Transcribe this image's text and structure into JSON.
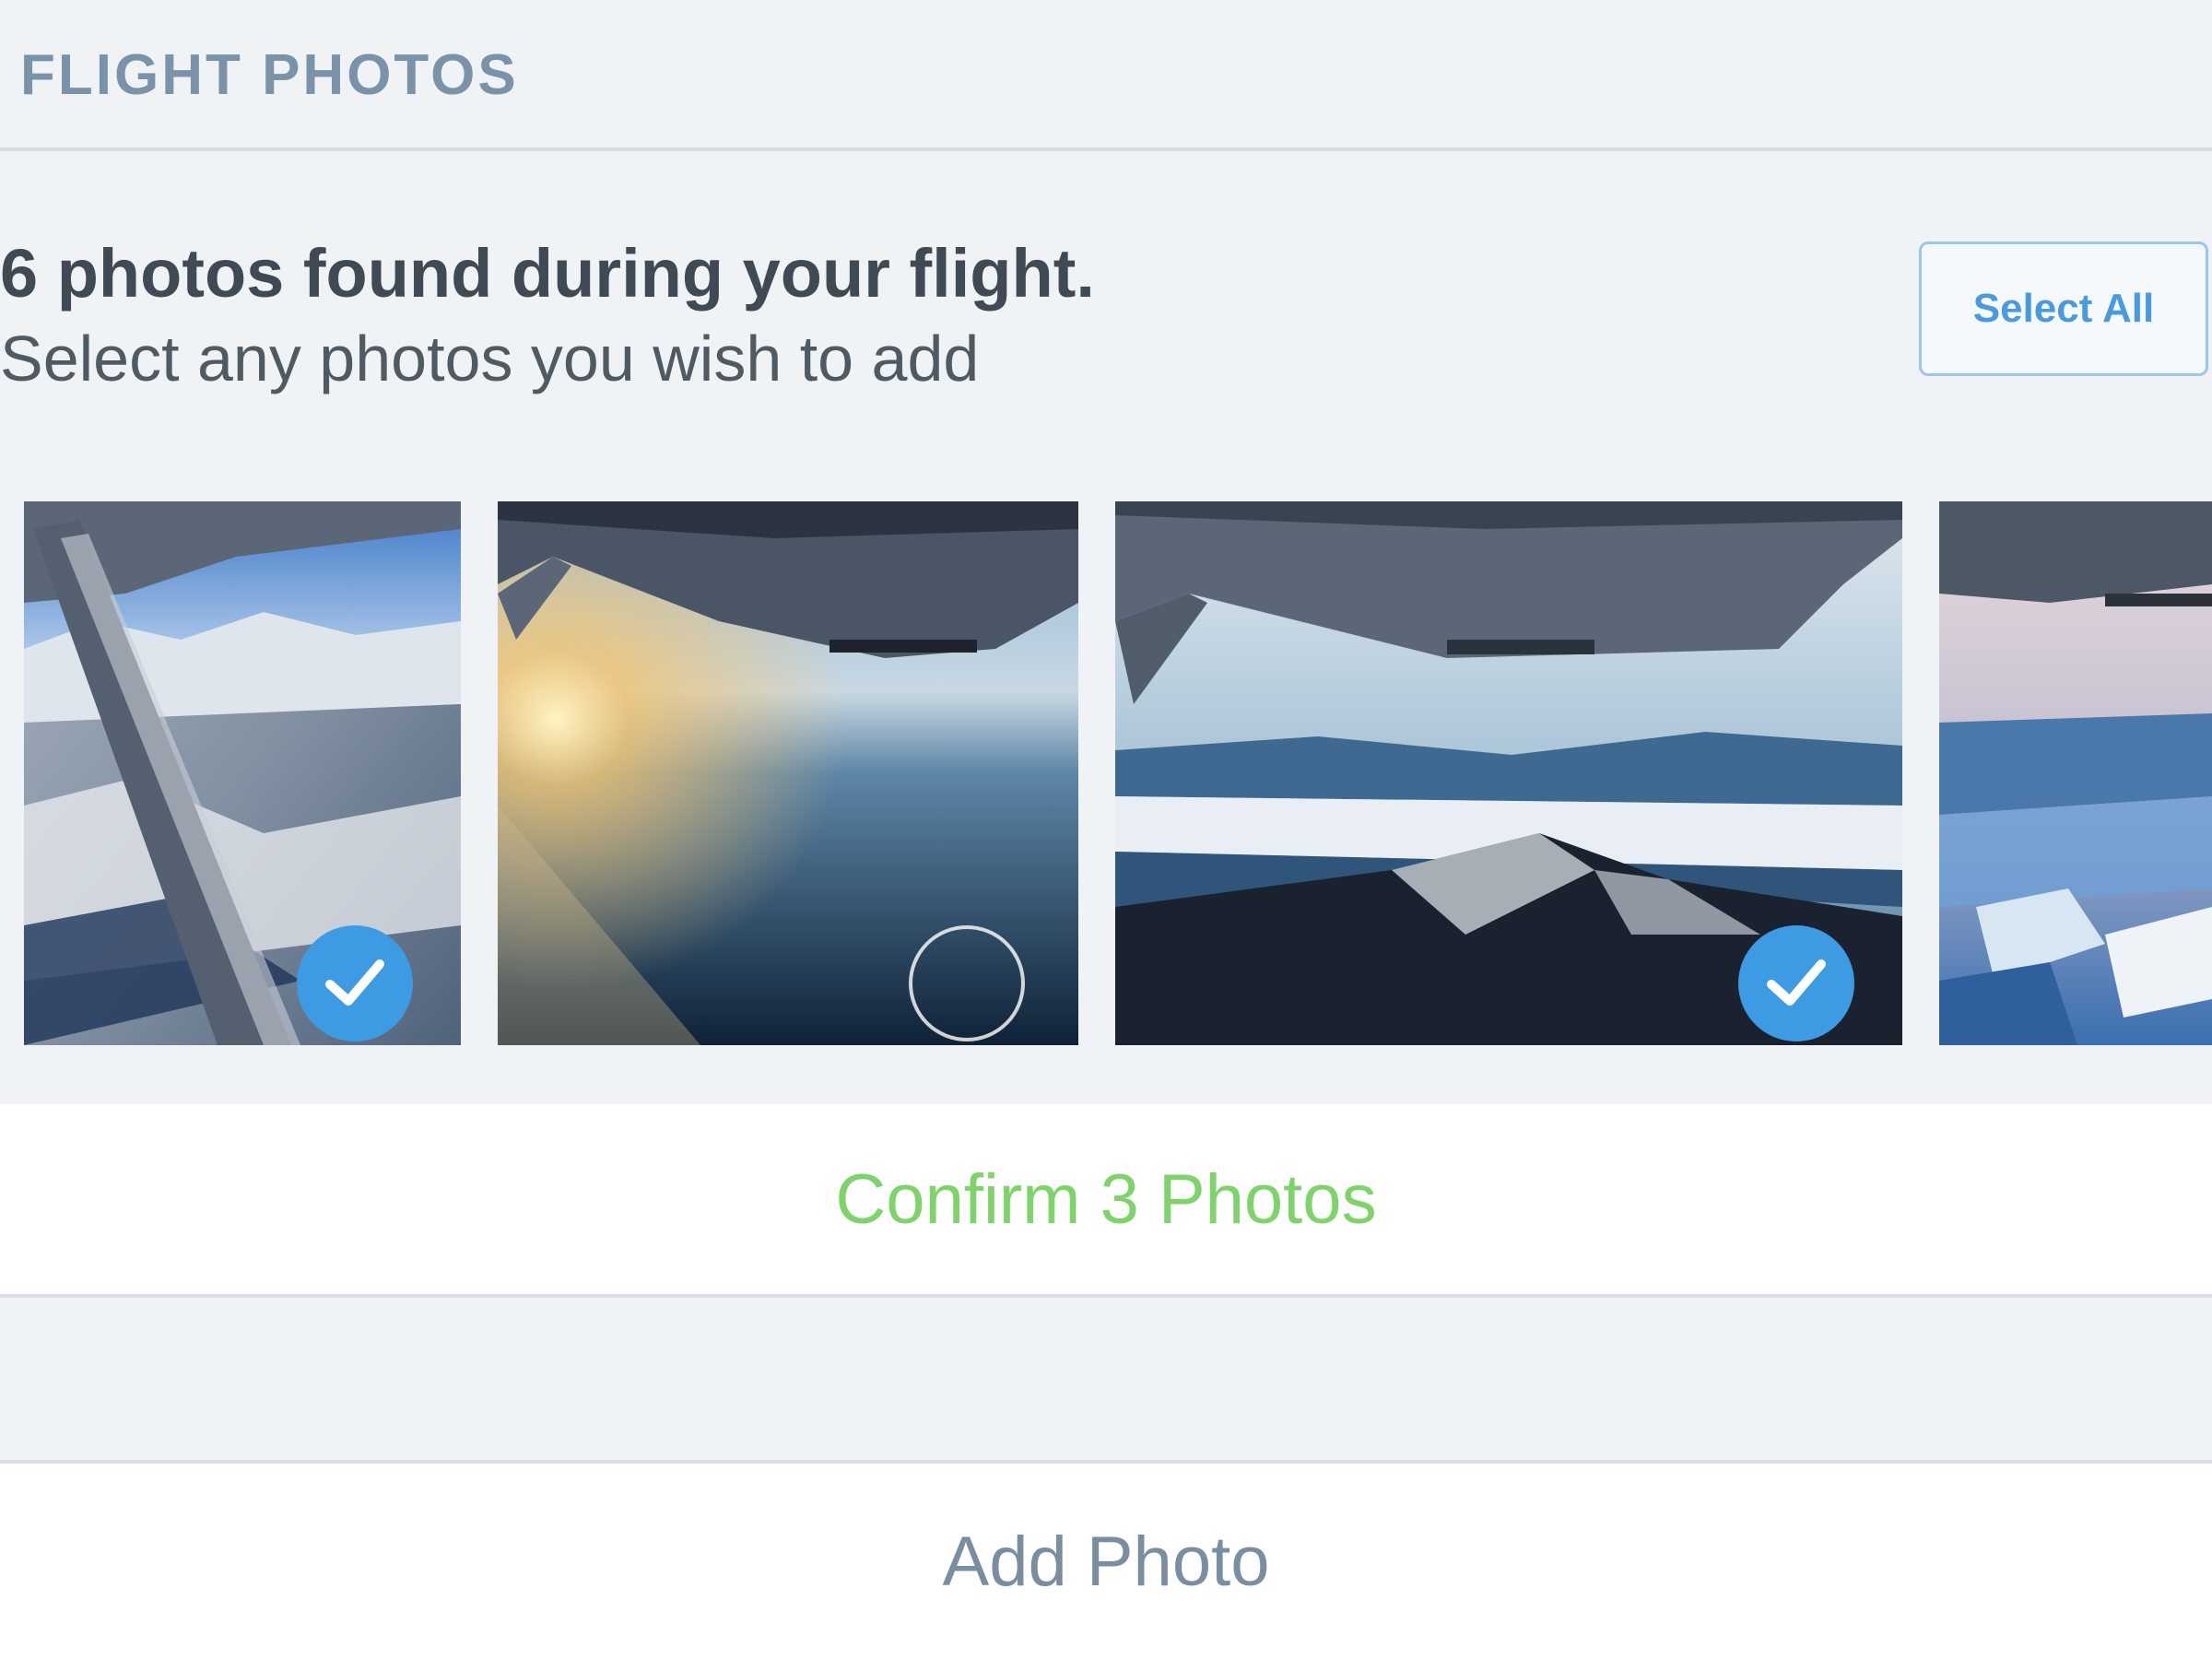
{
  "section": {
    "title": "FLIGHT PHOTOS"
  },
  "intro": {
    "headline": "6 photos found during your flight.",
    "subtitle": "Select any photos you wish to add"
  },
  "actions": {
    "select_all_label": "Select All",
    "confirm_label": "Confirm 3 Photos",
    "add_photo_label": "Add Photo"
  },
  "photos": [
    {
      "selected": true
    },
    {
      "selected": false
    },
    {
      "selected": true
    },
    {
      "selected": false
    }
  ],
  "colors": {
    "accent_blue": "#3d9be3",
    "confirm_green": "#7ed46a",
    "muted_label": "#7b93a8",
    "background": "#f0f3f6"
  }
}
